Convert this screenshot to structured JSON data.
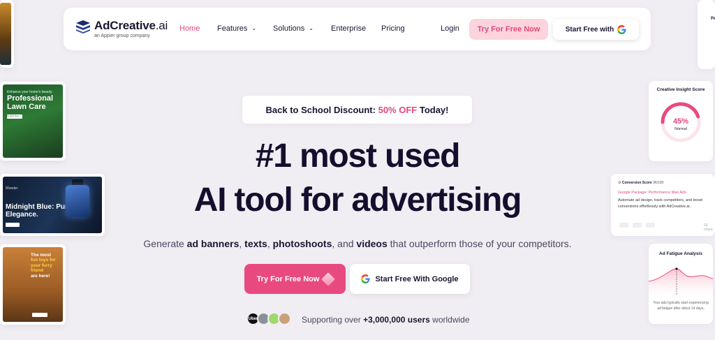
{
  "nav": {
    "logo_name": "AdCreative",
    "logo_suffix": ".ai",
    "logo_sub": "an Appier group company",
    "links": [
      {
        "label": "Home",
        "active": true
      },
      {
        "label": "Features",
        "dropdown": true
      },
      {
        "label": "Solutions",
        "dropdown": true
      },
      {
        "label": "Enterprise"
      },
      {
        "label": "Pricing"
      }
    ],
    "login": "Login",
    "try_btn": "Try For Free Now",
    "google_btn": "Start Free with"
  },
  "hero": {
    "promo_prefix": "Back to School Discount:",
    "promo_highlight": "50% OFF",
    "promo_suffix": "Today!",
    "headline_1": "#1 most used",
    "headline_2": "AI tool for advertising",
    "sub_1": "Generate ",
    "sub_b1": "ad banners",
    "sub_2": ", ",
    "sub_b2": "texts",
    "sub_3": ", ",
    "sub_b3": "photoshoots",
    "sub_4": ", and ",
    "sub_b4": "videos",
    "sub_5": " that outperform those of your competitors.",
    "cta_try": "Try For Free Now",
    "cta_google": "Start Free With Google",
    "support_prefix": "Supporting over ",
    "support_count": "+3,000,000 users",
    "support_suffix": " worldwide",
    "avatars": [
      "Uber",
      "",
      "",
      ""
    ]
  },
  "left_cards": {
    "lawn_small": "Enhance your home's beauty",
    "lawn_title": "Professional Lawn Care",
    "lawn_cta": "Contact Now",
    "fragrance_brand": "Wonder",
    "fragrance_title": "Midnight Blue: Pure Elegance.",
    "fragrance_cta": "Discover Now",
    "dog_line1": "The most",
    "dog_line2": "fun toys for",
    "dog_line3": "your furry",
    "dog_line4": "friend",
    "dog_line5": "are here!",
    "dog_cta": "Shop Now"
  },
  "right_cards": {
    "top_partial": "Pe",
    "insight_title": "Creative Insight Score",
    "insight_value": "45%",
    "insight_label": "Normal",
    "insight_score_fraction": 0.45,
    "conv_label": "Conversion Score",
    "conv_value": "96/100",
    "conv_ad_title": "Google Package: Performance Max Ads",
    "conv_desc": "Automate ad design, track competitors, and boost conversions effortlessly with AdCreative.ai.",
    "conv_chars": "93 chara",
    "fatigue_title": "Ad Fatigue Analysis",
    "fatigue_note": "Your ads typically start experiencing ad fatigue after about 14 days."
  },
  "colors": {
    "accent": "#e84a7f",
    "accent_soft": "#fbd4de",
    "text": "#1b1530",
    "bg": "#f1eef3"
  },
  "icons": [
    "google-icon",
    "chevron-down-icon",
    "gem-icon"
  ]
}
